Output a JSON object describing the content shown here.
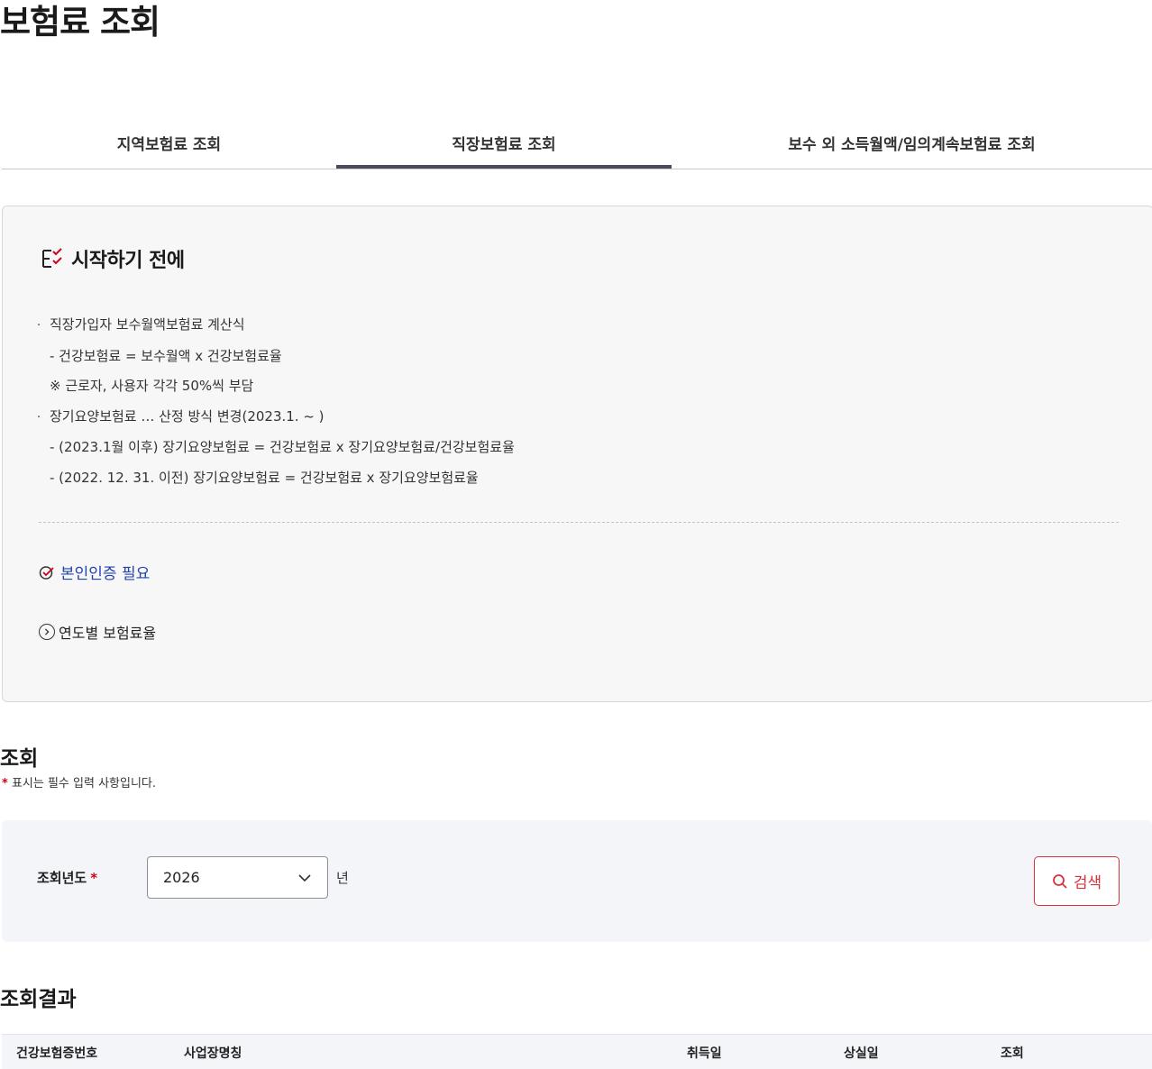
{
  "page": {
    "title": "보험료 조회"
  },
  "tabs": [
    {
      "label": "지역보험료 조회",
      "active": false
    },
    {
      "label": "직장보험료 조회",
      "active": true
    },
    {
      "label": "보수 외 소득월액/임의계속보험료 조회",
      "active": false
    }
  ],
  "info": {
    "title": "시작하기 전에",
    "lines": [
      {
        "bullet": "·",
        "text": "직장가입자 보수월액보험료 계산식"
      },
      {
        "text": "- 건강보험료 = 보수월액 x 건강보험료율"
      },
      {
        "text": "※ 근로자, 사용자 각각 50%씩 부담"
      },
      {
        "bullet": "·",
        "text": "장기요양보험료 … 산정 방식 변경(2023.1. ~ )"
      },
      {
        "text": "- (2023.1월 이후) 장기요양보험료 = 건강보험료 x 장기요양보험료/건강보험료율"
      },
      {
        "text": "- (2022. 12. 31. 이전) 장기요양보험료 = 건강보험료 x 장기요양보험료율"
      }
    ],
    "verify_label": "본인인증 필요",
    "yearly_rate_label": "연도별 보험료율"
  },
  "query": {
    "title": "조회",
    "required_star": "*",
    "required_note": "표시는 필수 입력 사항입니다.",
    "year_label": "조회년도",
    "year_value": "2026",
    "year_unit": "년",
    "search_label": "검색"
  },
  "results": {
    "title": "조회결과",
    "columns": [
      "건강보험증번호",
      "사업장명칭",
      "취득일",
      "상실일",
      "조회"
    ]
  },
  "colors": {
    "accent_red": "#d8323c",
    "tab_active": "#4a4a5e",
    "link_blue": "#2244aa",
    "panel_bg": "#f4f5f9"
  }
}
